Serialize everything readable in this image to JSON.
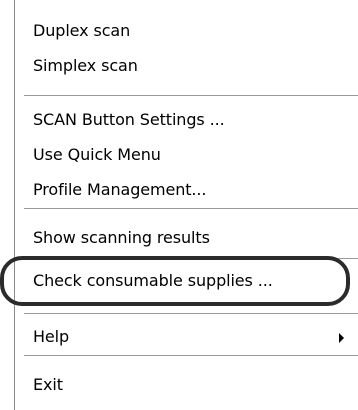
{
  "context_menu": {
    "groups": [
      {
        "items": [
          {
            "label": "Duplex scan"
          },
          {
            "label": "Simplex scan"
          }
        ]
      },
      {
        "items": [
          {
            "label": "SCAN Button Settings ..."
          },
          {
            "label": "Use Quick Menu"
          },
          {
            "label": "Profile Management..."
          }
        ]
      },
      {
        "items": [
          {
            "label": "Show scanning results"
          }
        ]
      },
      {
        "items": [
          {
            "label": "Check consumable supplies ...",
            "highlighted": true
          }
        ]
      },
      {
        "items": [
          {
            "label": "Help",
            "has_submenu": true,
            "submenu_icon": "triangle-right"
          }
        ]
      },
      {
        "items": [
          {
            "label": "Exit"
          }
        ]
      }
    ]
  },
  "colors": {
    "separator": "#9a9a9a",
    "highlight_ring": "#2b2b2b",
    "text": "#000000"
  }
}
